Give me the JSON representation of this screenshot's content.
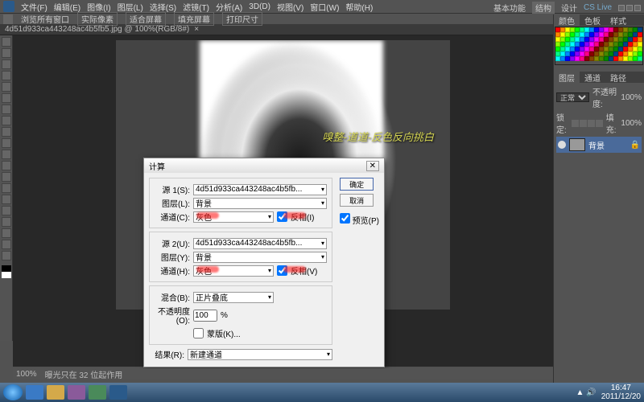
{
  "menubar": {
    "items": [
      "文件(F)",
      "编辑(E)",
      "图像(I)",
      "图层(L)",
      "选择(S)",
      "滤镜(T)",
      "分析(A)",
      "3D(D)",
      "视图(V)",
      "窗口(W)",
      "帮助(H)"
    ]
  },
  "topRight": {
    "items": [
      "基本功能",
      "结构",
      "设计"
    ],
    "cslive": "CS Live"
  },
  "subbar": {
    "left": "浏览所有窗口",
    "btns": [
      "实际像素",
      "适合屏幕",
      "填充屏幕",
      "打印尺寸"
    ]
  },
  "tab": {
    "label": "4d51d933ca443248ac4b5fb5.jpg @ 100%(RGB/8#)"
  },
  "overlay": {
    "text": "嗅整-道道-反色反向挑白"
  },
  "dialog": {
    "title": "计算",
    "source1": {
      "label": "源 1(S):",
      "file": "4d51d933ca443248ac4b5fb...",
      "layerLabel": "图层(L):",
      "layer": "背景",
      "channelLabel": "通道(C):",
      "channel": "灰色",
      "invert": "反相(I)"
    },
    "source2": {
      "label": "源 2(U):",
      "file": "4d51d933ca443248ac4b5fb...",
      "layerLabel": "图层(Y):",
      "layer": "背景",
      "channelLabel": "通道(H):",
      "channel": "灰色",
      "invert": "反相(V)"
    },
    "blend": {
      "label": "混合(B):",
      "mode": "正片叠底",
      "opacityLabel": "不透明度(O):",
      "opacity": "100",
      "pct": "%",
      "mask": "蒙版(K)..."
    },
    "result": {
      "label": "结果(R):",
      "value": "新建通道"
    },
    "buttons": {
      "ok": "确定",
      "cancel": "取消",
      "preview": "预览(P)"
    }
  },
  "rpanel": {
    "colorTabs": [
      "颜色",
      "色板",
      "样式"
    ],
    "layerTabs": [
      "图层",
      "通道",
      "路径"
    ],
    "blendMode": "正常",
    "opacityLabel": "不透明度:",
    "opacity": "100%",
    "lock": "锁定:",
    "fillLabel": "填充:",
    "fill": "100%",
    "layerName": "背景"
  },
  "status": {
    "zoom": "100%",
    "info": "曝光只在 32 位起作用"
  },
  "taskbar": {
    "time": "16:47",
    "date": "2011/12/20"
  },
  "chart_data": null
}
